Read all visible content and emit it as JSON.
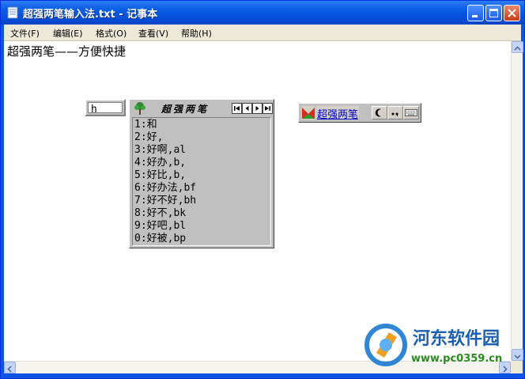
{
  "window": {
    "title": "超强两笔输入法.txt - 记事本"
  },
  "menu": [
    {
      "label": "文件(F)"
    },
    {
      "label": "编辑(E)"
    },
    {
      "label": "格式(O)"
    },
    {
      "label": "查看(V)"
    },
    {
      "label": "帮助(H)"
    }
  ],
  "document": {
    "text": "超强两笔——方便快捷"
  },
  "ime": {
    "composition": "h",
    "candidate_title": "超强两笔",
    "candidates": [
      "1:和",
      "2:好,",
      "3:好啊,al",
      "4:好办,b,",
      "5:好比,b,",
      "6:好办法,bf",
      "7:好不好,bh",
      "8:好不,bk",
      "9:好吧,bl",
      "0:好被,bp"
    ],
    "nav_buttons": [
      "first-page",
      "prev-page",
      "next-page",
      "last-page"
    ],
    "status_name": "超强两笔"
  },
  "watermark": {
    "name": "河东软件园",
    "url": "www.pc0359.cn"
  },
  "colors": {
    "titlebar": "#0a5fe6",
    "menubar": "#ece9d8",
    "ime_gray": "#c0c0c0",
    "status_link": "#0000cc"
  }
}
